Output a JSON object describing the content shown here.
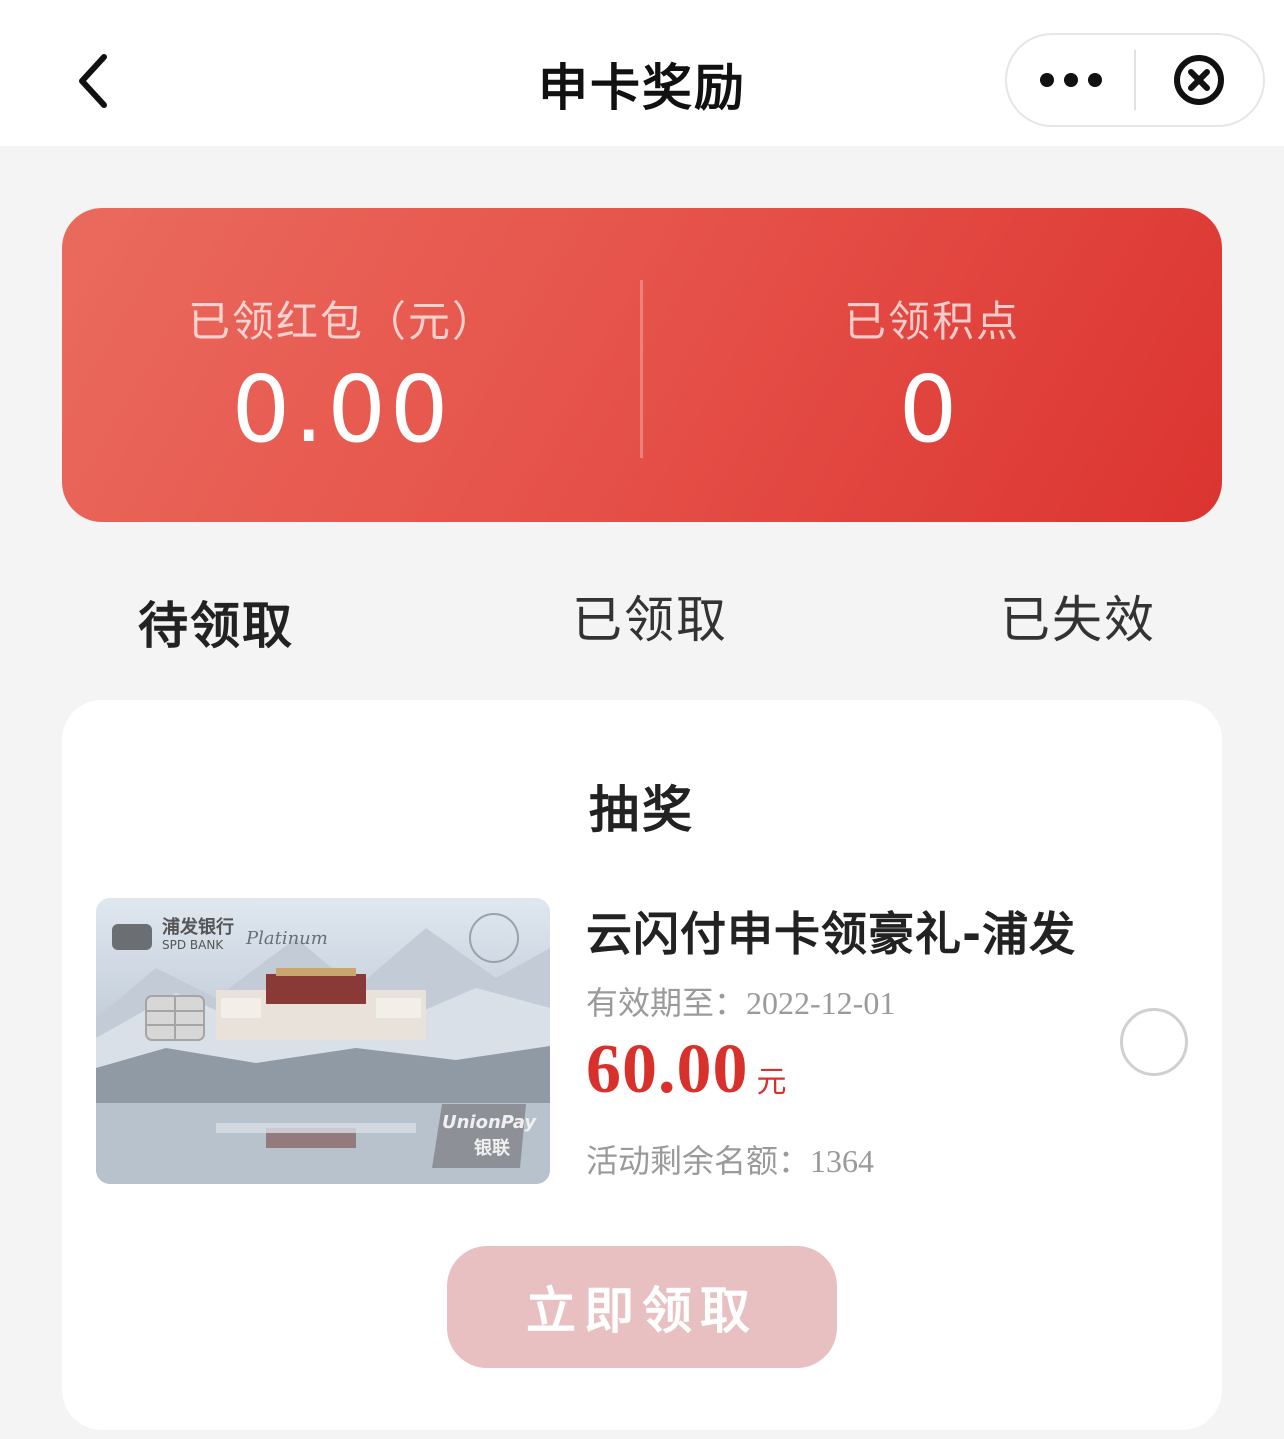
{
  "navbar": {
    "title": "申卡奖励",
    "back_icon": "chevron-left-icon",
    "more_icon": "more-dots-icon",
    "close_icon": "close-circle-icon"
  },
  "stats": {
    "red_packet_label": "已领红包（元）",
    "red_packet_value": "0.00",
    "points_label": "已领积点",
    "points_value": "0"
  },
  "tabs": [
    {
      "label": "待领取",
      "active": true
    },
    {
      "label": "已领取",
      "active": false
    },
    {
      "label": "已失效",
      "active": false
    }
  ],
  "reward": {
    "section_title": "抽奖",
    "card_image": {
      "bank_name": "浦发银行",
      "bank_name_en": "SPD BANK",
      "tier": "Platinum",
      "network": "UnionPay",
      "network_cn": "银联"
    },
    "name": "云闪付申卡领豪礼-浦发",
    "expiry_label": "有效期至：",
    "expiry_date": "2022-12-01",
    "amount": "60.00",
    "amount_unit": "元",
    "quota_label": "活动剩余名额：",
    "quota_count": "1364",
    "selected": false,
    "claim_button": "立即领取"
  },
  "colors": {
    "accent_red": "#d8302b",
    "stats_gradient_start": "#ea6a5e",
    "stats_gradient_end": "#dc3430",
    "claim_button_disabled": "#e8c0c1"
  }
}
